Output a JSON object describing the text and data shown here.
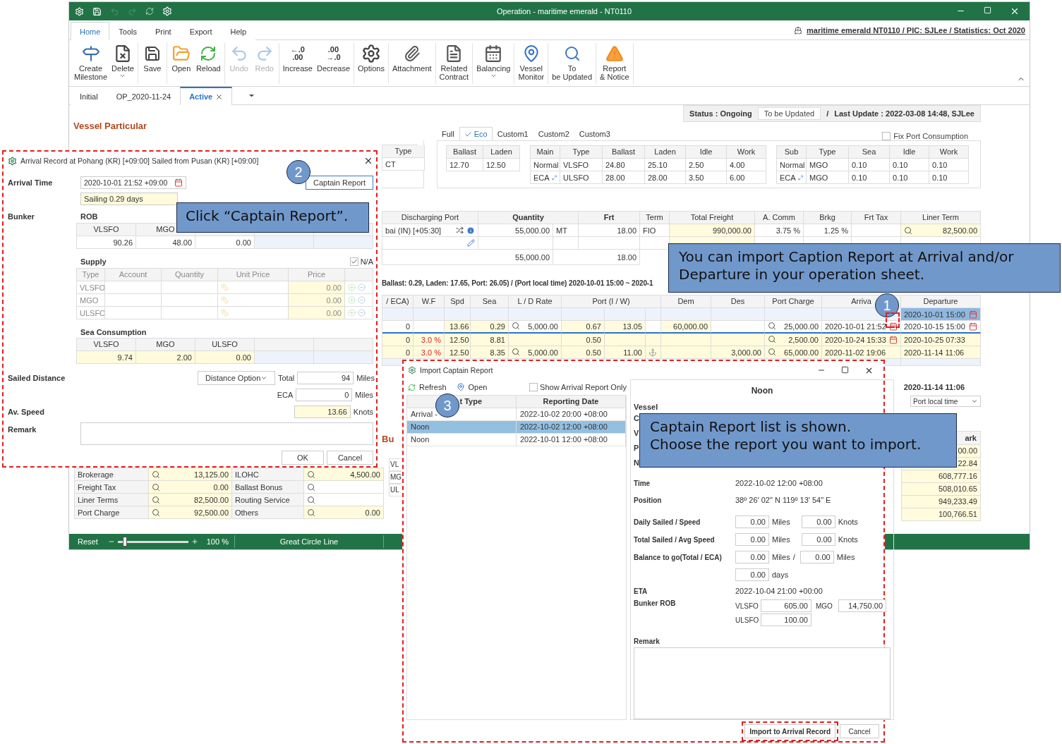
{
  "window": {
    "title": "Operation - maritime emerald - NT0110"
  },
  "menu_tabs": [
    {
      "label": "Home",
      "selected": true
    },
    {
      "label": "Tools",
      "selected": false
    },
    {
      "label": "Print",
      "selected": false
    },
    {
      "label": "Export",
      "selected": false
    },
    {
      "label": "Help",
      "selected": false
    }
  ],
  "header_link": "maritime emerald NT0110 / PIC: SJLee / Statistics: Oct 2020",
  "ribbon": [
    [
      {
        "label": "Create Milestone",
        "disabled": false,
        "dropdown": false
      },
      {
        "label": "Delete",
        "disabled": false,
        "dropdown": true
      }
    ],
    [
      {
        "label": "Save",
        "disabled": false,
        "dropdown": false
      }
    ],
    [
      {
        "label": "Open",
        "disabled": false,
        "dropdown": false
      },
      {
        "label": "Reload",
        "disabled": false,
        "dropdown": false
      }
    ],
    [
      {
        "label": "Undo",
        "disabled": true,
        "dropdown": false
      },
      {
        "label": "Redo",
        "disabled": true,
        "dropdown": false
      }
    ],
    [
      {
        "label": "Increase",
        "glyph": [
          "←.0",
          ".00"
        ],
        "disabled": false,
        "dropdown": false
      },
      {
        "label": "Decrease",
        "glyph": [
          ".00",
          "→.0"
        ],
        "disabled": false,
        "dropdown": false
      }
    ],
    [
      {
        "label": "Options",
        "disabled": false,
        "dropdown": false
      }
    ],
    [
      {
        "label": "Attachment",
        "disabled": false,
        "dropdown": false
      }
    ],
    [
      {
        "label": "Related Contract",
        "disabled": false,
        "dropdown": false
      }
    ],
    [
      {
        "label": "Balancing",
        "disabled": false,
        "dropdown": true
      }
    ],
    [
      {
        "label": "Vessel Monitor",
        "disabled": false,
        "dropdown": false
      }
    ],
    [
      {
        "label": "To be Updated",
        "disabled": false,
        "dropdown": false
      }
    ],
    [
      {
        "label": "Report & Notice",
        "disabled": false,
        "dropdown": false
      }
    ]
  ],
  "doc_tabs": [
    {
      "label": "Initial",
      "selected": false,
      "closable": false
    },
    {
      "label": "OP_2020-11-24",
      "selected": false,
      "closable": false
    },
    {
      "label": "Active",
      "selected": true,
      "closable": true
    }
  ],
  "status": {
    "label": "Status : Ongoing",
    "button": "To be Updated",
    "separator": "/",
    "last_update": "Last Update : 2022-03-08 14:48, SJLee"
  },
  "section_title": "Vessel Particular",
  "consumption_tabs": [
    {
      "label": "Full",
      "selected": false
    },
    {
      "label": "Eco",
      "selected": true
    },
    {
      "label": "Custom1",
      "selected": false
    },
    {
      "label": "Custom2",
      "selected": false
    },
    {
      "label": "Custom3",
      "selected": false
    }
  ],
  "fix_port_consumption": {
    "label": "Fix Port Consumption",
    "checked": false
  },
  "type_box": {
    "header": "Type",
    "value": "CT"
  },
  "speed_table": {
    "columns": [
      "Ballast",
      "Laden"
    ],
    "rows": [
      [
        "12.70",
        "12.50"
      ]
    ]
  },
  "main_consumption": {
    "columns": [
      "Main",
      "Type",
      "Ballast",
      "Laden",
      "Idle",
      "Work"
    ],
    "rows": [
      [
        "Normal",
        "VLSFO",
        "24.80",
        "25.10",
        "2.50",
        "4.00"
      ],
      [
        "ECA",
        "ULSFO",
        "28.00",
        "28.00",
        "3.50",
        "6.00"
      ]
    ]
  },
  "sub_consumption": {
    "columns": [
      "Sub",
      "Type",
      "Sea",
      "Idle",
      "Work"
    ],
    "rows": [
      [
        "Normal",
        "MGO",
        "0.10",
        "0.10",
        "0.10"
      ],
      [
        "ECA",
        "MGO",
        "0.10",
        "0.10",
        "0.10"
      ]
    ]
  },
  "cargo_table": {
    "columns": [
      "Discharging Port",
      "Quantity",
      "Frt",
      "Term",
      "Total Freight",
      "A. Comm",
      "Brkg",
      "Frt Tax",
      "Liner Term"
    ],
    "rows": [
      {
        "kind": "cargo",
        "port": "bai (IN) [+05:30]",
        "quantity": "55,000.00",
        "unit": "MT",
        "frt": "18.00",
        "term": "FIO",
        "total_freight": "990,000.00",
        "a_comm": "3.75 %",
        "brkg": "1.25 %",
        "liner_term": "82,500.00"
      },
      {
        "kind": "new"
      },
      {
        "kind": "total",
        "quantity": "55,000.00",
        "frt": "18.00"
      }
    ]
  },
  "voyage_summary": "Ballast: 0.29, Laden: 17.65, Port: 26.05) / (Port local time) 2020-10-01 15:00 ~ 2020-1",
  "itinerary": {
    "columns": [
      "/ ECA)",
      "W.F",
      "Spd",
      "Sea",
      "L / D Rate",
      "Port (I / W)",
      "Dem",
      "Des",
      "Port Charge",
      "Arriva",
      "Departure"
    ],
    "rows": [
      {
        "departure": "2020-10-01 15:00",
        "departure_focused": true,
        "selected": false,
        "arrival_calendar": false,
        "departure_calendar": true,
        "anchor": false
      },
      {
        "eca": "0",
        "spd": "13.66",
        "sea": "0.29",
        "ld_rate": "5,000.00",
        "port_i": "0.67",
        "port_w": "13.05",
        "dem": "60,000.00",
        "port_charge": "25,000.00",
        "arrival": "2020-10-01 21:52",
        "departure": "2020-10-15 15:00",
        "departure_focused": false,
        "selected": true,
        "arrival_calendar": true,
        "departure_calendar": true,
        "anchor": false
      },
      {
        "eca": "0",
        "wf": "3.0 %",
        "spd": "12.50",
        "sea": "8.81",
        "port_i": "0.50",
        "port_charge": "2,500.00",
        "arrival": "2020-10-24 15:33",
        "departure": "2020-10-25 07:33",
        "departure_focused": false,
        "selected": false,
        "arrival_calendar": true,
        "departure_calendar": false,
        "anchor": false
      },
      {
        "eca": "0",
        "wf": "3.0 %",
        "spd": "12.50",
        "sea": "8.35",
        "ld_rate": "5,000.00",
        "port_i": "0.50",
        "port_w": "11.00",
        "des": "3,000.00",
        "port_charge": "65,000.00",
        "arrival": "2020-11-02 19:06",
        "departure": "2020-11-14 11:06",
        "departure_focused": false,
        "selected": false,
        "arrival_calendar": false,
        "departure_calendar": false,
        "anchor": true
      }
    ]
  },
  "fragment": {
    "title": "Bu",
    "rows": [
      "VL",
      "MG",
      "UL"
    ]
  },
  "right_strip": {
    "departure": "2020-11-14 11:06",
    "dropdown": "Port local time",
    "header": "ark",
    "values": [
      "00.00",
      "22.84",
      "608,777.16",
      "508,010.65",
      "949,233.49",
      "100,766.51"
    ]
  },
  "costs": [
    {
      "left": {
        "label": "Brokerage",
        "value": "13,125.00"
      },
      "right": {
        "label": "ILOHC",
        "value": "4,500.00"
      }
    },
    {
      "left": {
        "label": "Freight Tax",
        "value": "0.00"
      },
      "right": {
        "label": "Ballast Bonus"
      }
    },
    {
      "left": {
        "label": "Liner Terms",
        "value": "82,500.00"
      },
      "right": {
        "label": "Routing Service"
      }
    },
    {
      "left": {
        "label": "Port Charge",
        "value": "92,500.00"
      },
      "right": {
        "label": "Others",
        "value": "0.00"
      }
    }
  ],
  "status_bar": {
    "reset": "Reset",
    "zoom": {
      "level": 0.1
    },
    "zoom_text": "100 %",
    "map_mode": "Great Circle Line"
  },
  "arrival_dialog": {
    "title": "Arrival Record at Pohang (KR) [+09:00] Sailed from Pusan (KR) [+09:00]",
    "captain_report_button": "Captain Report",
    "arrival_time": {
      "label": "Arrival Time",
      "value": "2020-10-01 21:52 +09:00",
      "sailing": "Sailing 0.29 days"
    },
    "bunker": {
      "label": "Bunker",
      "rob_title": "ROB",
      "columns": [
        "VLSFO",
        "MGO"
      ],
      "values": [
        "90.26",
        "48.00",
        "0.00"
      ]
    },
    "supply": {
      "title": "Supply",
      "na": {
        "label": "N/A",
        "checked": true
      },
      "disabled": true,
      "columns": [
        "Type",
        "Account",
        "Quantity",
        "Unit Price",
        "Price"
      ],
      "rows": [
        {
          "type": "VLSFO",
          "price": "0.00"
        },
        {
          "type": "MGO",
          "price": "0.00"
        },
        {
          "type": "ULSFO",
          "price": "0.00"
        }
      ]
    },
    "sea_consumption": {
      "title": "Sea Consumption",
      "columns": [
        "VLSFO",
        "MGO",
        "ULSFO"
      ],
      "values": [
        "9.74",
        "2.00",
        "0.00"
      ]
    },
    "sailed_distance": {
      "label": "Sailed Distance",
      "option": "Distance Option",
      "total_label": "Total",
      "total": "94",
      "total_unit": "Miles",
      "eca_label": "ECA",
      "eca": "0",
      "eca_unit": "Miles"
    },
    "av_speed": {
      "label": "Av. Speed",
      "value": "13.66",
      "unit": "Knots"
    },
    "remark_label": "Remark",
    "buttons": [
      "OK",
      "Cancel"
    ]
  },
  "import_dialog": {
    "title": "Import Captain Report",
    "toolbar": [
      "Refresh",
      "Open"
    ],
    "arrival_only": {
      "label": "Show Arrival Report Only",
      "checked": false
    },
    "columns": [
      "t Type",
      "Reporting Date"
    ],
    "rows": [
      {
        "type": "Arrival -",
        "date": "2022-10-02 20:00 +08:00",
        "selected": false
      },
      {
        "type": "Noon",
        "date": "2022-10-02 12:00 +08:00",
        "selected": true
      },
      {
        "type": "Noon",
        "date": "2022-10-01 12:00 +08:00",
        "selected": false
      }
    ],
    "detail": {
      "title": "Noon",
      "vessel_label": "Vessel",
      "cut_labels": [
        "C",
        "V",
        "P",
        "N"
      ],
      "time": {
        "label": "Time",
        "value": "2022-10-02 12:00 +08:00"
      },
      "position": {
        "label": "Position",
        "value": "38º 26' 02\" N 119º 13' 54\" E"
      },
      "pairs": [
        {
          "label": "Daily Sailed / Speed",
          "a": "0.00",
          "a_unit": "Miles",
          "b": "0.00",
          "b_unit": "Knots"
        },
        {
          "label": "Total Sailed / Avg Speed",
          "a": "0.00",
          "a_unit": "Miles",
          "b": "0.00",
          "b_unit": "Knots"
        },
        {
          "label": "Balance to go(Total / ECA)",
          "a": "0.00",
          "a_unit": "Miles",
          "sep": "/",
          "b": "0.00",
          "b_unit": "Miles"
        }
      ],
      "days": {
        "value": "0.00",
        "unit": "days"
      },
      "eta": {
        "label": "ETA",
        "value": "2022-10-04 21:00 +00:00"
      },
      "bunker_rob": {
        "label": "Bunker ROB",
        "items": [
          {
            "fuel": "VLSFO",
            "value": "605.00"
          },
          {
            "fuel": "MGO",
            "value": "14,750.00"
          },
          {
            "fuel": "ULSFO",
            "value": "100.00"
          }
        ]
      },
      "remark_label": "Remark"
    },
    "buttons": [
      {
        "label": "Import to Arrival Record",
        "highlighted": true
      },
      {
        "label": "Cancel",
        "highlighted": false
      }
    ]
  },
  "callouts": [
    "Click “Captain Report”.",
    "You can import Caption Report at Arrival and/or Departure in your operation sheet.",
    "Captain Report list is shown.\nChoose the report you want to import."
  ],
  "step_markers": [
    "1",
    "2",
    "3"
  ]
}
